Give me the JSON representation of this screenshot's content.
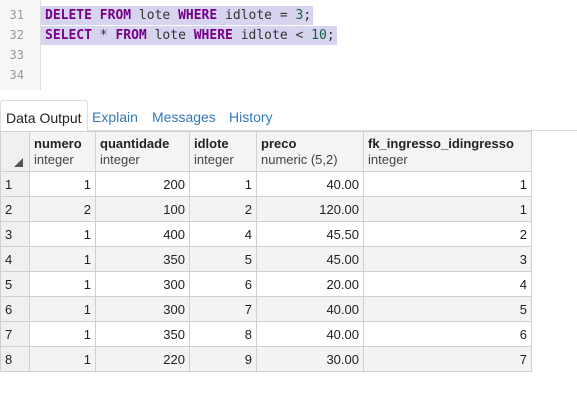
{
  "editor": {
    "lines": [
      {
        "num": "31",
        "parts": [
          [
            "kw",
            "DELETE"
          ],
          [
            "t",
            " "
          ],
          [
            "kw",
            "FROM"
          ],
          [
            "t",
            " lote "
          ],
          [
            "kw",
            "WHERE"
          ],
          [
            "t",
            " idlote = "
          ],
          [
            "num",
            "3"
          ],
          [
            "t",
            ";"
          ]
        ],
        "selected": true
      },
      {
        "num": "32",
        "parts": [
          [
            "kw",
            "SELECT"
          ],
          [
            "t",
            " * "
          ],
          [
            "kw",
            "FROM"
          ],
          [
            "t",
            " lote "
          ],
          [
            "kw",
            "WHERE"
          ],
          [
            "t",
            " idlote < "
          ],
          [
            "num",
            "10"
          ],
          [
            "t",
            ";"
          ]
        ],
        "selected": true
      },
      {
        "num": "33",
        "parts": [],
        "selected": false
      },
      {
        "num": "34",
        "parts": [],
        "selected": false
      }
    ]
  },
  "tabs": [
    "Data Output",
    "Explain",
    "Messages",
    "History"
  ],
  "active_tab": "Data Output",
  "grid": {
    "columns": [
      {
        "name": "numero",
        "type": "integer"
      },
      {
        "name": "quantidade",
        "type": "integer"
      },
      {
        "name": "idlote",
        "type": "integer"
      },
      {
        "name": "preco",
        "type": "numeric (5,2)"
      },
      {
        "name": "fk_ingresso_idingresso",
        "type": "integer"
      }
    ],
    "rows": [
      [
        "1",
        "1",
        "200",
        "1",
        "40.00",
        "1"
      ],
      [
        "2",
        "2",
        "100",
        "2",
        "120.00",
        "1"
      ],
      [
        "3",
        "1",
        "400",
        "4",
        "45.50",
        "2"
      ],
      [
        "4",
        "1",
        "350",
        "5",
        "45.00",
        "3"
      ],
      [
        "5",
        "1",
        "300",
        "6",
        "20.00",
        "4"
      ],
      [
        "6",
        "1",
        "300",
        "7",
        "40.00",
        "5"
      ],
      [
        "7",
        "1",
        "350",
        "8",
        "40.00",
        "6"
      ],
      [
        "8",
        "1",
        "220",
        "9",
        "30.00",
        "7"
      ]
    ]
  }
}
